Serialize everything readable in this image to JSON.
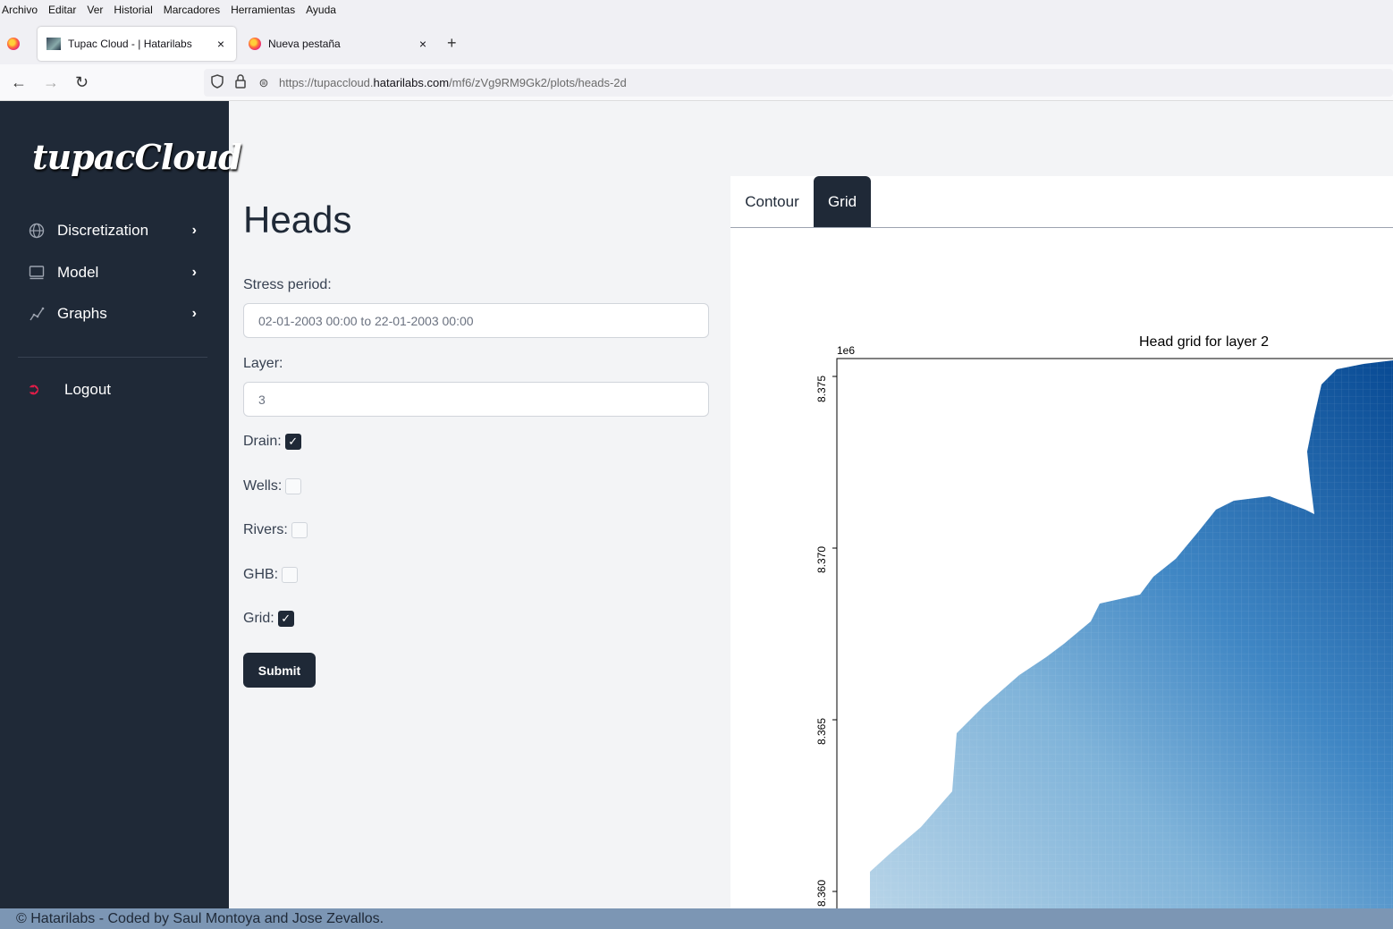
{
  "browser": {
    "menu": [
      "Archivo",
      "Editar",
      "Ver",
      "Historial",
      "Marcadores",
      "Herramientas",
      "Ayuda"
    ],
    "tabs": [
      {
        "title": "Tupac Cloud - | Hatarilabs",
        "close": "×"
      },
      {
        "title": "Nueva pestaña",
        "close": "×"
      }
    ],
    "new_tab": "+",
    "url_prefix": "https://tupaccloud.",
    "url_domain": "hatarilabs.com",
    "url_path": "/mf6/zVg9RM9Gk2/plots/heads-2d"
  },
  "sidebar": {
    "logo": "tupacCloud",
    "items": [
      {
        "label": "Discretization",
        "icon": "globe-icon"
      },
      {
        "label": "Model",
        "icon": "monitor-icon"
      },
      {
        "label": "Graphs",
        "icon": "line-chart-icon"
      }
    ],
    "logout": "Logout"
  },
  "form": {
    "title": "Heads",
    "stress_period_label": "Stress period:",
    "stress_period_value": "02-01-2003 00:00 to 22-01-2003 00:00",
    "layer_label": "Layer:",
    "layer_value": "3",
    "checks": [
      {
        "label": "Drain:",
        "checked": true
      },
      {
        "label": "Wells:",
        "checked": false
      },
      {
        "label": "Rivers:",
        "checked": false
      },
      {
        "label": "GHB:",
        "checked": false
      },
      {
        "label": "Grid:",
        "checked": true
      }
    ],
    "submit": "Submit"
  },
  "plot": {
    "tabs": [
      "Contour",
      "Grid"
    ],
    "active_tab": "Grid",
    "title": "Head grid for layer 2",
    "offset_label": "1e6",
    "y_ticks": [
      "8.375",
      "8.370",
      "8.365",
      "8.360"
    ]
  },
  "footer": {
    "text": "© Hatarilabs - Coded by Saul Montoya and Jose Zevallos."
  }
}
